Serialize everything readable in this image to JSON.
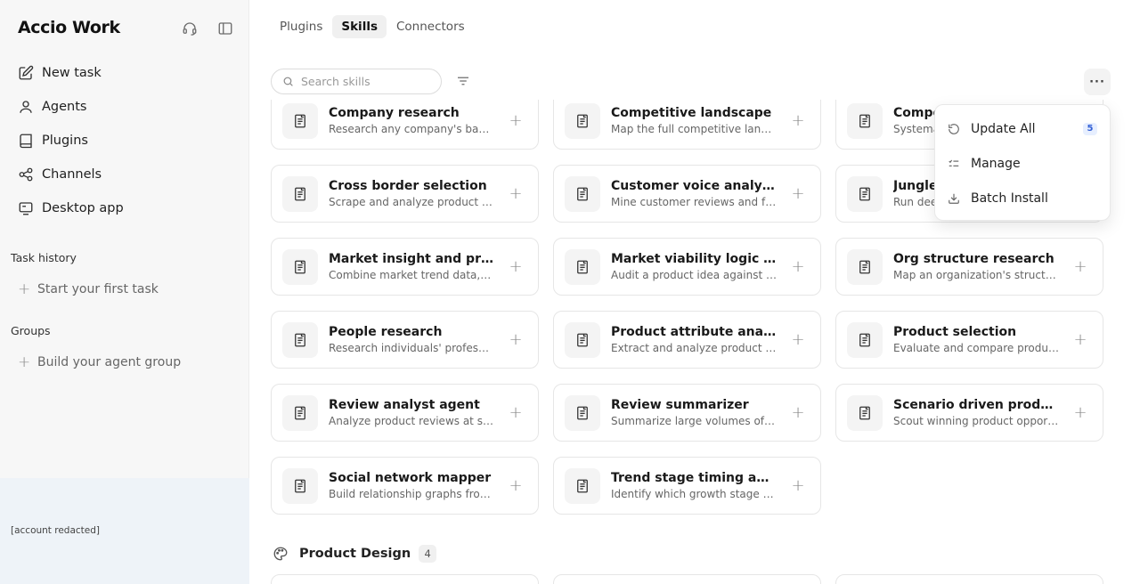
{
  "app": {
    "name": "Accio Work"
  },
  "sidebar": {
    "nav": [
      {
        "label": "New task",
        "icon": "edit-icon"
      },
      {
        "label": "Agents",
        "icon": "user-icon"
      },
      {
        "label": "Plugins",
        "icon": "book-icon"
      },
      {
        "label": "Channels",
        "icon": "share-icon"
      },
      {
        "label": "Desktop app",
        "icon": "monitor-icon"
      }
    ],
    "task_history": {
      "title": "Task history",
      "action": "Start your first task"
    },
    "groups": {
      "title": "Groups",
      "action": "Build your agent group"
    },
    "account": "[account redacted]"
  },
  "tabs": [
    {
      "label": "Plugins",
      "active": false
    },
    {
      "label": "Skills",
      "active": true
    },
    {
      "label": "Connectors",
      "active": false
    }
  ],
  "search": {
    "placeholder": "Search skills"
  },
  "more_button": "···",
  "skills": [
    {
      "name": "Company research",
      "desc": "Research any company's background and business"
    },
    {
      "name": "Competitive landscape",
      "desc": "Map the full competitive landscape of a market"
    },
    {
      "name": "Compe",
      "desc": "Systema"
    },
    {
      "name": "Cross border selection",
      "desc": "Scrape and analyze product data across borders"
    },
    {
      "name": "Customer voice analyzer",
      "desc": "Mine customer reviews and feedback"
    },
    {
      "name": "Jungle",
      "desc": "Run dee"
    },
    {
      "name": "Market insight and product",
      "desc": "Combine market trend data, signals"
    },
    {
      "name": "Market viability logic audit",
      "desc": "Audit a product idea against market"
    },
    {
      "name": "Org structure research",
      "desc": "Map an organization's structure"
    },
    {
      "name": "People research",
      "desc": "Research individuals' professional background"
    },
    {
      "name": "Product attribute analyzer",
      "desc": "Extract and analyze product attributes"
    },
    {
      "name": "Product selection",
      "desc": "Evaluate and compare products"
    },
    {
      "name": "Review analyst agent",
      "desc": "Analyze product reviews at scale"
    },
    {
      "name": "Review summarizer",
      "desc": "Summarize large volumes of product reviews"
    },
    {
      "name": "Scenario driven product discovery",
      "desc": "Scout winning product opportunities"
    },
    {
      "name": "Social network mapper",
      "desc": "Build relationship graphs from social data"
    },
    {
      "name": "Trend stage timing analyzer",
      "desc": "Identify which growth stage a trend is in"
    }
  ],
  "section": {
    "title": "Product Design",
    "count": "4"
  },
  "menu": {
    "items": [
      {
        "label": "Update All",
        "icon": "refresh-icon",
        "badge": "5"
      },
      {
        "label": "Manage",
        "icon": "list-check-icon"
      },
      {
        "label": "Batch Install",
        "icon": "download-icon"
      }
    ]
  }
}
